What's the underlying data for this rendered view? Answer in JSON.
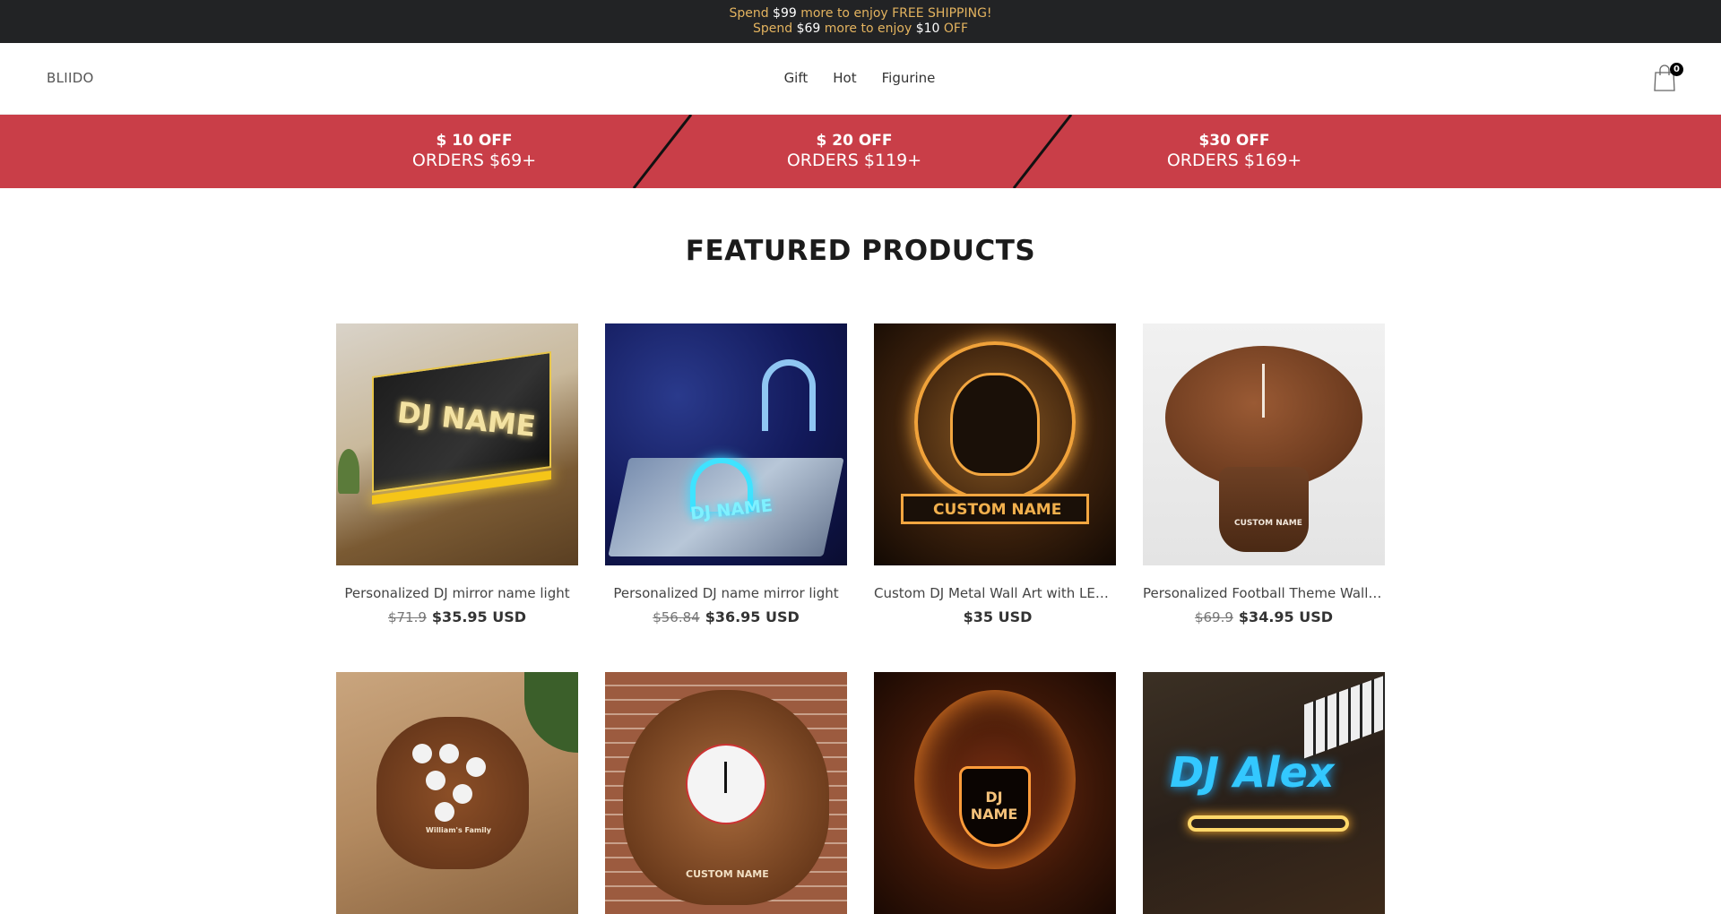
{
  "announcement": {
    "line1": {
      "pre": "Spend ",
      "amount": "$99",
      "post": " more to enjoy FREE SHIPPING!"
    },
    "line2": {
      "pre": "Spend ",
      "amount": "$69",
      "mid": " more to enjoy ",
      "discount": "$10",
      "post": " OFF"
    }
  },
  "header": {
    "logo": "BLIIDO",
    "nav": [
      "Gift",
      "Hot",
      "Figurine"
    ],
    "cart_count": "0"
  },
  "promo": [
    {
      "line1": "$ 10 OFF",
      "line2": "ORDERS $69+"
    },
    {
      "line1": "$ 20 OFF",
      "line2": "ORDERS $119+"
    },
    {
      "line1": "$30 OFF",
      "line2": "ORDERS $169+"
    }
  ],
  "featured": {
    "title": "FEATURED PRODUCTS",
    "products": [
      {
        "title": "Personalized DJ mirror name light",
        "old_price": "$71.9",
        "price": "$35.95 USD",
        "image_text": "DJ NAME"
      },
      {
        "title": "Personalized DJ name mirror light",
        "old_price": "$56.84",
        "price": "$36.95 USD",
        "image_text": "DJ NAME"
      },
      {
        "title": "Custom DJ Metal Wall Art with LED Light",
        "old_price": "",
        "price": "$35 USD",
        "image_text": "CUSTOM NAME"
      },
      {
        "title": "Personalized Football Theme Wall Clock",
        "old_price": "$69.9",
        "price": "$34.95 USD",
        "image_text": "CUSTOM NAME"
      },
      {
        "title": "",
        "old_price": "",
        "price": "",
        "image_text": "William's Family"
      },
      {
        "title": "",
        "old_price": "",
        "price": "",
        "image_text": "CUSTOM NAME"
      },
      {
        "title": "",
        "old_price": "",
        "price": "",
        "image_text": "DJ NAME"
      },
      {
        "title": "",
        "old_price": "",
        "price": "",
        "image_text": "DJ Alex"
      }
    ]
  },
  "colors": {
    "announce_bg": "#222325",
    "announce_text": "#e3b35f",
    "promo_bg": "#c93e48"
  }
}
